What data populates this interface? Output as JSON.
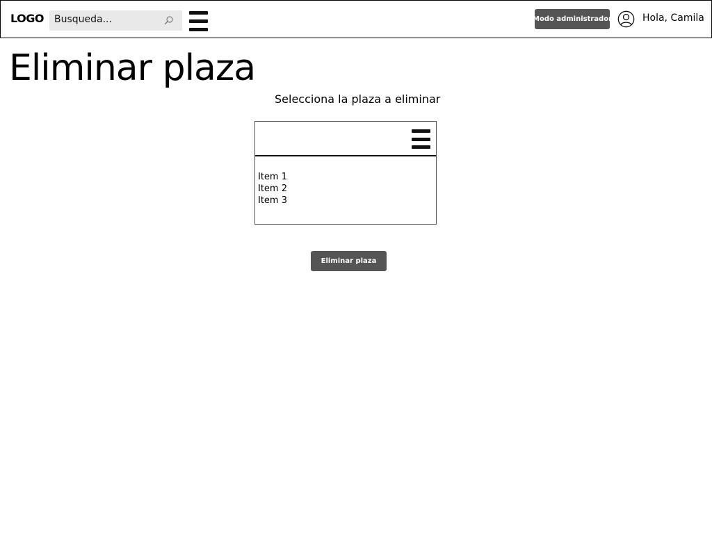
{
  "header": {
    "logo": "LOGO",
    "search": {
      "placeholder": "Busqueda..."
    },
    "admin_button": "Modo administrador",
    "greeting": "Hola, Camila"
  },
  "main": {
    "title": "Eliminar plaza",
    "subtitle": "Selecciona la plaza a eliminar",
    "items": [
      {
        "label": "Item 1"
      },
      {
        "label": "Item 2"
      },
      {
        "label": "Item 3"
      }
    ],
    "delete_button": "Eliminar plaza"
  },
  "icons": {
    "search": "search-icon",
    "header_menu": "hamburger-menu-icon",
    "user": "user-avatar-icon",
    "select_menu": "hamburger-menu-icon"
  },
  "colors": {
    "button_bg": "#555555",
    "search_bg": "#e9e9e9"
  }
}
